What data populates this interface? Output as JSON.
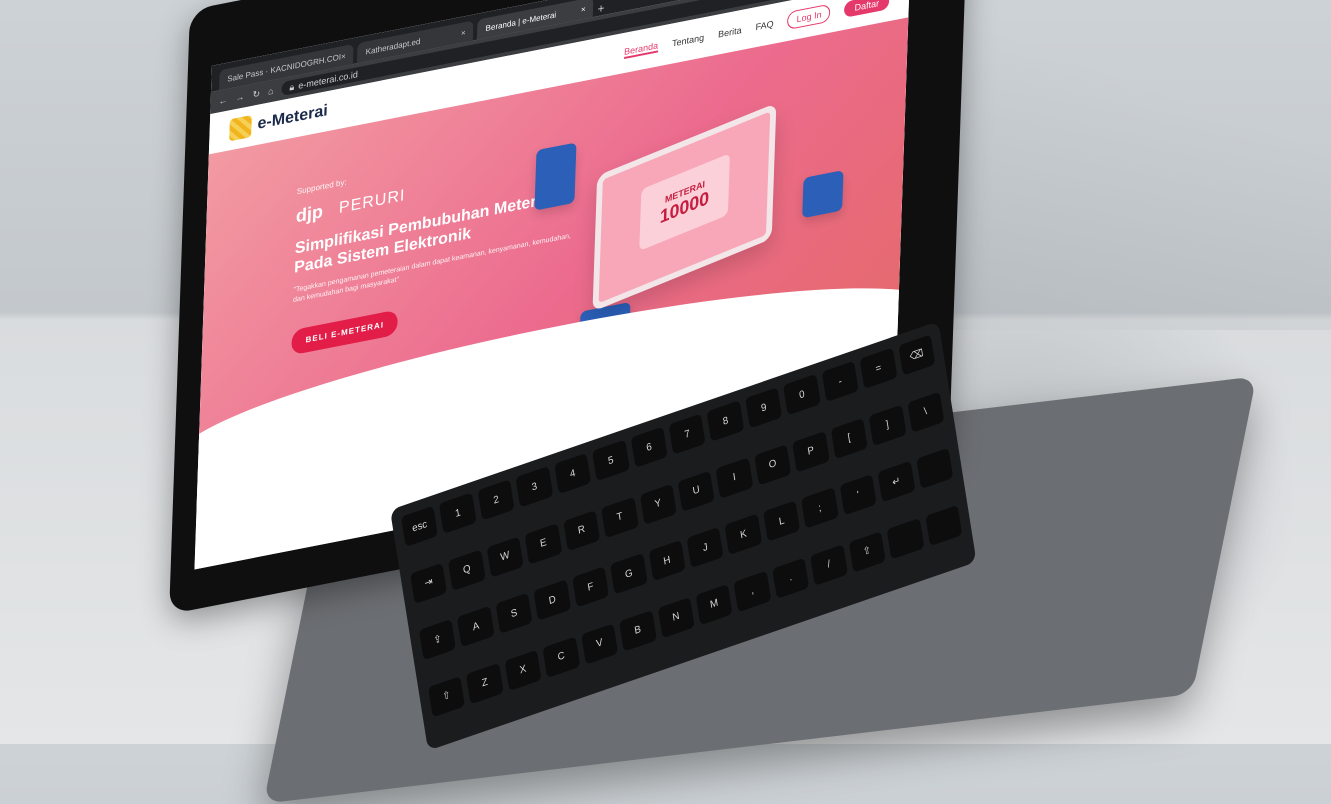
{
  "browser": {
    "tabs": [
      {
        "label": "Sale Pass · KACNIDOGRH.COI",
        "active": false
      },
      {
        "label": "Katheradapt.ed",
        "active": false
      },
      {
        "label": "Beranda | e-Meterai",
        "active": true
      }
    ],
    "url": "e-meterai.co.id"
  },
  "site": {
    "logo_text": "e-Meterai",
    "nav": [
      "Beranda",
      "Tentang",
      "Berita",
      "FAQ"
    ],
    "login_label": "Log In",
    "register_label": "Daftar"
  },
  "hero": {
    "supported_by": "Supported by:",
    "partner_1": "djp",
    "partner_2": "PERURI",
    "headline_1": "Simplifikasi Pembubuhan Meterai",
    "headline_2": "Pada Sistem Elektronik",
    "tagline": "\"Tegakkan pengamanan pemeteraian dalam dapat keamanan, kenyamanan, kemudahan, dan kemudahan bagi masyarakat\"",
    "cta_label": "BELI E-METERAI"
  },
  "stamp": {
    "label": "METERAI",
    "value": "10000"
  },
  "keyboard": {
    "keys": [
      "esc",
      "1",
      "2",
      "3",
      "4",
      "5",
      "6",
      "7",
      "8",
      "9",
      "0",
      "-",
      "=",
      "⌫",
      "⇥",
      "Q",
      "W",
      "E",
      "R",
      "T",
      "Y",
      "U",
      "I",
      "O",
      "P",
      "[",
      "]",
      "\\",
      "⇪",
      "A",
      "S",
      "D",
      "F",
      "G",
      "H",
      "J",
      "K",
      "L",
      ";",
      "'",
      "↵",
      "",
      "⇧",
      "Z",
      "X",
      "C",
      "V",
      "B",
      "N",
      "M",
      ",",
      ".",
      "/",
      "⇧",
      "",
      ""
    ]
  },
  "colors": {
    "accent": "#e5396b",
    "hero_start": "#f29aa2",
    "hero_end": "#e56a6c",
    "cta": "#e11d48"
  }
}
